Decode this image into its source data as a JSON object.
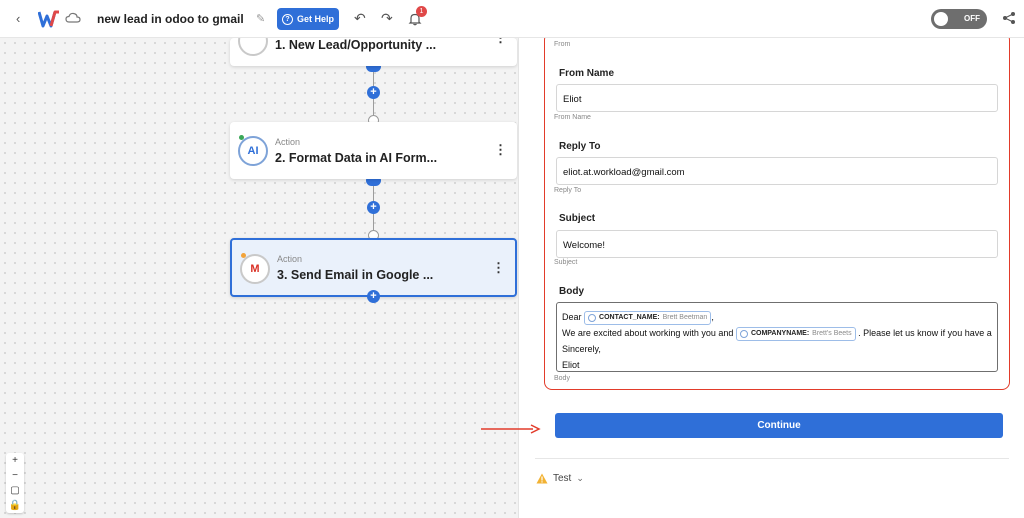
{
  "header": {
    "back_icon": "chevron-left-icon",
    "workflow_title": "new lead in odoo to gmail",
    "help_label": "Get Help",
    "notifications_count": "1",
    "toggle_label": "OFF"
  },
  "canvas": {
    "nodes": [
      {
        "type": "",
        "title": "1. New Lead/Opportunity ..."
      },
      {
        "type": "Action",
        "title": "2. Format Data in AI Form...",
        "icon_text": "AI"
      },
      {
        "type": "Action",
        "title": "3. Send Email in Google ...",
        "icon_text": "M"
      }
    ]
  },
  "panel": {
    "top_hint": "From",
    "fields": [
      {
        "label": "From Name",
        "value": "Eliot",
        "hint": "From Name"
      },
      {
        "label": "Reply To",
        "value": "eliot.at.workload@gmail.com",
        "hint": "Reply To"
      },
      {
        "label": "Subject",
        "value": "Welcome!",
        "hint": "Subject"
      }
    ],
    "body": {
      "label": "Body",
      "hint": "Body",
      "line1_prefix": "Dear",
      "chip1_key": "CONTACT_NAME:",
      "chip1_value": "Brett Beetman",
      "line1_suffix": ",",
      "line2_prefix": "We are excited about working with you and",
      "chip2_key": "COMPANYNAME:",
      "chip2_value": "Brett's Beets",
      "line2_suffix": ". Please let us know if you have a",
      "line3": "Sincerely,",
      "line4": "Eliot"
    },
    "continue_label": "Continue",
    "test_label": "Test"
  },
  "colors": {
    "accent": "#2f6fd8",
    "highlight_border": "#e23b2a"
  }
}
